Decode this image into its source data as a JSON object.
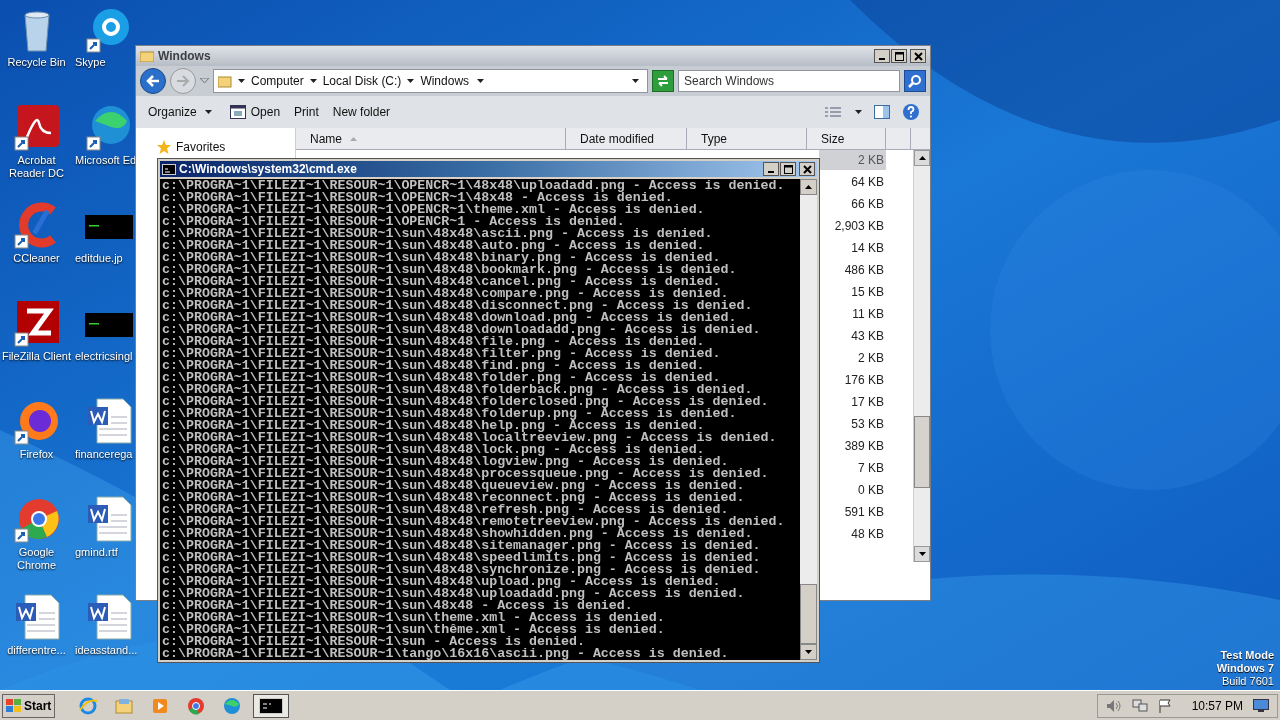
{
  "desktop_icons": [
    {
      "label": "Recycle Bin",
      "kind": "recycle"
    },
    {
      "label": "Skype",
      "kind": "skype"
    },
    {
      "label": "Acrobat Reader DC",
      "kind": "acrobat"
    },
    {
      "label": "Microsoft Ed",
      "kind": "edge"
    },
    {
      "label": "CCleaner",
      "kind": "ccleaner"
    },
    {
      "label": "editdue.jp"
    },
    {
      "label": "FileZilla Client",
      "kind": "filezilla"
    },
    {
      "label": "electricsingl"
    },
    {
      "label": "Firefox",
      "kind": "firefox"
    },
    {
      "label": "financerega",
      "kind": "word"
    },
    {
      "label": "Google Chrome",
      "kind": "chrome"
    },
    {
      "label": "gmind.rtf",
      "kind": "word"
    },
    {
      "label": "differentre...",
      "kind": "word"
    },
    {
      "label": "ideasstand...",
      "kind": "word"
    }
  ],
  "explorer": {
    "title": "Windows",
    "breadcrumbs": [
      "Computer",
      "Local Disk (C:)",
      "Windows"
    ],
    "search": {
      "placeholder": "Search Windows"
    },
    "toolbar": [
      {
        "label": "Organize",
        "kind": "menu"
      },
      {
        "label": "Open",
        "kind": "open"
      },
      {
        "label": "Print",
        "kind": "plain"
      },
      {
        "label": "New folder",
        "kind": "plain"
      }
    ],
    "nav": [
      {
        "label": "Favorites"
      }
    ],
    "columns": [
      "Name",
      "Date modified",
      "Type",
      "Size"
    ],
    "rows": [
      {
        "size": "2 KB",
        "selected": true
      },
      {
        "size": "64 KB",
        "selected": false
      },
      {
        "size": "66 KB",
        "selected": false
      },
      {
        "size": "2,903 KB",
        "selected": false
      },
      {
        "size": "14 KB",
        "selected": false
      },
      {
        "size": "486 KB",
        "selected": false
      },
      {
        "size": "15 KB",
        "selected": false
      },
      {
        "size": "11 KB",
        "selected": false
      },
      {
        "size": "43 KB",
        "selected": false
      },
      {
        "size": "2 KB",
        "selected": false
      },
      {
        "size": "176 KB",
        "selected": false
      },
      {
        "size": "17 KB",
        "selected": false
      },
      {
        "size": "53 KB",
        "selected": false
      },
      {
        "size": "389 KB",
        "selected": false
      },
      {
        "size": "7 KB",
        "selected": false
      },
      {
        "size": "0 KB",
        "selected": false
      },
      {
        "size": "591 KB",
        "selected": false
      },
      {
        "size": "48 KB",
        "selected": false
      }
    ]
  },
  "cmd": {
    "title": "C:\\Windows\\system32\\cmd.exe",
    "lines": [
      "c:\\PROGRA~1\\FILEZI~1\\RESOUR~1\\OPENCR~1\\48x48\\uploadadd.png - Access is denied.",
      "c:\\PROGRA~1\\FILEZI~1\\RESOUR~1\\OPENCR~1\\48x48 - Access is denied.",
      "c:\\PROGRA~1\\FILEZI~1\\RESOUR~1\\OPENCR~1\\theme.xml - Access is denied.",
      "c:\\PROGRA~1\\FILEZI~1\\RESOUR~1\\OPENCR~1 - Access is denied.",
      "c:\\PROGRA~1\\FILEZI~1\\RESOUR~1\\sun\\48x48\\ascii.png - Access is denied.",
      "c:\\PROGRA~1\\FILEZI~1\\RESOUR~1\\sun\\48x48\\auto.png - Access is denied.",
      "c:\\PROGRA~1\\FILEZI~1\\RESOUR~1\\sun\\48x48\\binary.png - Access is denied.",
      "c:\\PROGRA~1\\FILEZI~1\\RESOUR~1\\sun\\48x48\\bookmark.png - Access is denied.",
      "c:\\PROGRA~1\\FILEZI~1\\RESOUR~1\\sun\\48x48\\cancel.png - Access is denied.",
      "c:\\PROGRA~1\\FILEZI~1\\RESOUR~1\\sun\\48x48\\compare.png - Access is denied.",
      "c:\\PROGRA~1\\FILEZI~1\\RESOUR~1\\sun\\48x48\\disconnect.png - Access is denied.",
      "c:\\PROGRA~1\\FILEZI~1\\RESOUR~1\\sun\\48x48\\download.png - Access is denied.",
      "c:\\PROGRA~1\\FILEZI~1\\RESOUR~1\\sun\\48x48\\downloadadd.png - Access is denied.",
      "c:\\PROGRA~1\\FILEZI~1\\RESOUR~1\\sun\\48x48\\file.png - Access is denied.",
      "c:\\PROGRA~1\\FILEZI~1\\RESOUR~1\\sun\\48x48\\filter.png - Access is denied.",
      "c:\\PROGRA~1\\FILEZI~1\\RESOUR~1\\sun\\48x48\\find.png - Access is denied.",
      "c:\\PROGRA~1\\FILEZI~1\\RESOUR~1\\sun\\48x48\\folder.png - Access is denied.",
      "c:\\PROGRA~1\\FILEZI~1\\RESOUR~1\\sun\\48x48\\folderback.png - Access is denied.",
      "c:\\PROGRA~1\\FILEZI~1\\RESOUR~1\\sun\\48x48\\folderclosed.png - Access is denied.",
      "c:\\PROGRA~1\\FILEZI~1\\RESOUR~1\\sun\\48x48\\folderup.png - Access is denied.",
      "c:\\PROGRA~1\\FILEZI~1\\RESOUR~1\\sun\\48x48\\help.png - Access is denied.",
      "c:\\PROGRA~1\\FILEZI~1\\RESOUR~1\\sun\\48x48\\localtreeview.png - Access is denied.",
      "c:\\PROGRA~1\\FILEZI~1\\RESOUR~1\\sun\\48x48\\lock.png - Access is denied.",
      "c:\\PROGRA~1\\FILEZI~1\\RESOUR~1\\sun\\48x48\\logview.png - Access is denied.",
      "c:\\PROGRA~1\\FILEZI~1\\RESOUR~1\\sun\\48x48\\processqueue.png - Access is denied.",
      "c:\\PROGRA~1\\FILEZI~1\\RESOUR~1\\sun\\48x48\\queueview.png - Access is denied.",
      "c:\\PROGRA~1\\FILEZI~1\\RESOUR~1\\sun\\48x48\\reconnect.png - Access is denied.",
      "c:\\PROGRA~1\\FILEZI~1\\RESOUR~1\\sun\\48x48\\refresh.png - Access is denied.",
      "c:\\PROGRA~1\\FILEZI~1\\RESOUR~1\\sun\\48x48\\remotetreeview.png - Access is denied.",
      "c:\\PROGRA~1\\FILEZI~1\\RESOUR~1\\sun\\48x48\\showhidden.png - Access is denied.",
      "c:\\PROGRA~1\\FILEZI~1\\RESOUR~1\\sun\\48x48\\sitemanager.png - Access is denied.",
      "c:\\PROGRA~1\\FILEZI~1\\RESOUR~1\\sun\\48x48\\speedlimits.png - Access is denied.",
      "c:\\PROGRA~1\\FILEZI~1\\RESOUR~1\\sun\\48x48\\synchronize.png - Access is denied.",
      "c:\\PROGRA~1\\FILEZI~1\\RESOUR~1\\sun\\48x48\\upload.png - Access is denied.",
      "c:\\PROGRA~1\\FILEZI~1\\RESOUR~1\\sun\\48x48\\uploadadd.png - Access is denied.",
      "c:\\PROGRA~1\\FILEZI~1\\RESOUR~1\\sun\\48x48 - Access is denied.",
      "c:\\PROGRA~1\\FILEZI~1\\RESOUR~1\\sun\\theme.xml - Access is denied.",
      "c:\\PROGRA~1\\FILEZI~1\\RESOUR~1\\sun\\thême.xml - Access is denied.",
      "c:\\PROGRA~1\\FILEZI~1\\RESOUR~1\\sun - Access is denied.",
      "c:\\PROGRA~1\\FILEZI~1\\RESOUR~1\\tango\\16x16\\ascii.png - Access is denied."
    ]
  },
  "desktop_notice": [
    "Test Mode",
    "Windows 7",
    "Build 7601"
  ],
  "taskbar": {
    "start": "Start",
    "apps": [
      {
        "kind": "ie",
        "active": false
      },
      {
        "kind": "explorer",
        "active": false
      },
      {
        "kind": "media",
        "active": false
      },
      {
        "kind": "chrome",
        "active": false
      },
      {
        "kind": "edge",
        "active": false
      },
      {
        "kind": "cmd",
        "active": true
      }
    ],
    "clock": "10:57 PM"
  }
}
